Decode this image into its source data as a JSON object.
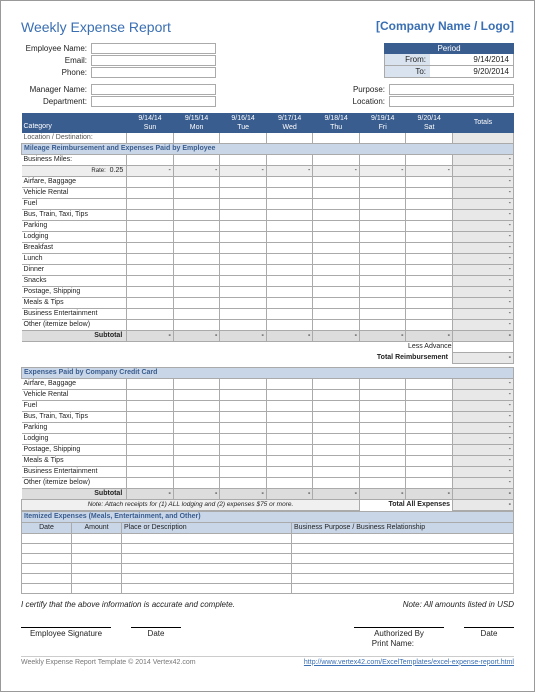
{
  "title": "Weekly Expense Report",
  "company": "[Company Name / Logo]",
  "employee_labels": {
    "name": "Employee Name:",
    "email": "Email:",
    "phone": "Phone:"
  },
  "manager_labels": {
    "manager": "Manager Name:",
    "dept": "Department:"
  },
  "right_labels": {
    "purpose": "Purpose:",
    "location": "Location:"
  },
  "period": {
    "header": "Period",
    "from_label": "From:",
    "to_label": "To:",
    "from": "9/14/2014",
    "to": "9/20/2014"
  },
  "cat_header": "Category",
  "totals_header": "Totals",
  "days": [
    {
      "date": "9/14/14",
      "dow": "Sun"
    },
    {
      "date": "9/15/14",
      "dow": "Mon"
    },
    {
      "date": "9/16/14",
      "dow": "Tue"
    },
    {
      "date": "9/17/14",
      "dow": "Wed"
    },
    {
      "date": "9/18/14",
      "dow": "Thu"
    },
    {
      "date": "9/19/14",
      "dow": "Fri"
    },
    {
      "date": "9/20/14",
      "dow": "Sat"
    }
  ],
  "loc_dest": "Location / Destination:",
  "section1": "Mileage Reimbursement and Expenses Paid by Employee",
  "business_miles": "Business Miles:",
  "rate_label": "Rate:",
  "rate_value": "0.25",
  "section1_rows": [
    "Airfare, Baggage",
    "Vehicle Rental",
    "Fuel",
    "Bus, Train, Taxi, Tips",
    "Parking",
    "Lodging",
    "Breakfast",
    "Lunch",
    "Dinner",
    "Snacks",
    "Postage, Shipping",
    "Meals & Tips",
    "Business Entertainment",
    "Other (itemize below)"
  ],
  "subtotal": "Subtotal",
  "less_advances": "Less Advances",
  "total_reimb": "Total Reimbursement",
  "section2": "Expenses Paid by Company Credit Card",
  "section2_rows": [
    "Airfare, Baggage",
    "Vehicle Rental",
    "Fuel",
    "Bus, Train, Taxi, Tips",
    "Parking",
    "Lodging",
    "Postage, Shipping",
    "Meals & Tips",
    "Business Entertainment",
    "Other (itemize below)"
  ],
  "note": "Note: Attach receipts for (1) ALL lodging and (2) expenses $75 or more.",
  "total_all": "Total All Expenses",
  "section3": "Itemized Expenses (Meals, Entertainment, and Other)",
  "itemized_cols": {
    "date": "Date",
    "amount": "Amount",
    "place": "Place or Description",
    "purpose": "Business Purpose / Business Relationship"
  },
  "cert": "I certify that the above information is accurate and complete.",
  "cert_note": "Note: All amounts listed in USD",
  "sig": {
    "emp": "Employee Signature",
    "date": "Date",
    "auth": "Authorized By",
    "print": "Print Name:"
  },
  "footer": {
    "left": "Weekly Expense Report Template © 2014 Vertex42.com",
    "right": "http://www.vertex42.com/ExcelTemplates/excel-expense-report.html"
  },
  "dash": "-"
}
